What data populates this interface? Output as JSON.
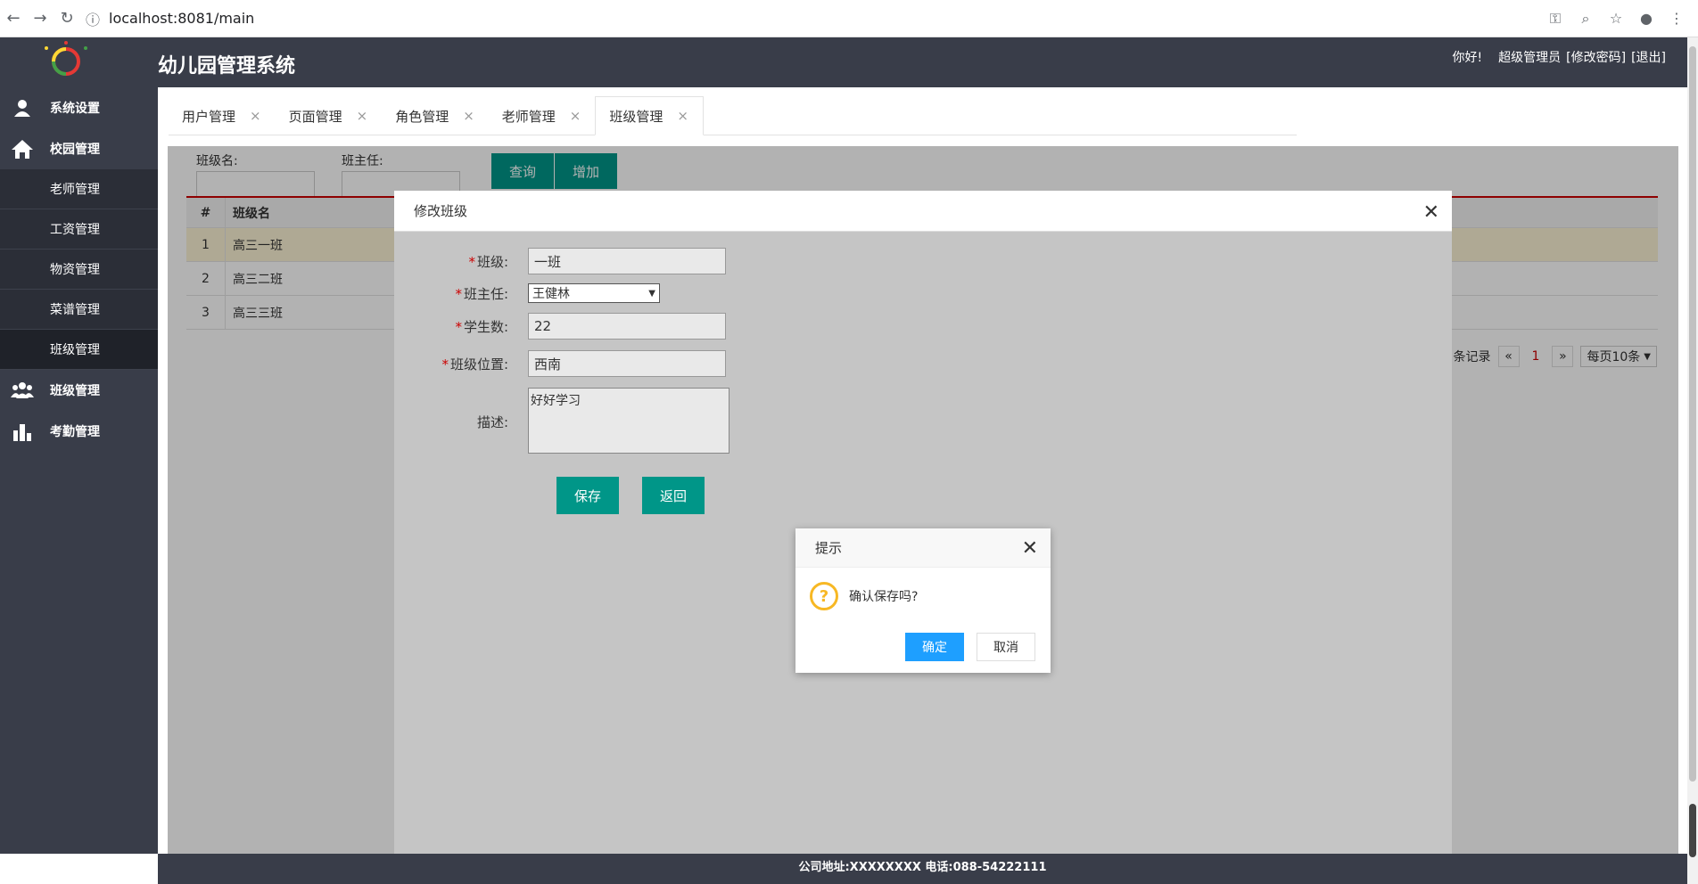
{
  "browser": {
    "url": "localhost:8081/main",
    "back_icon": "←",
    "forward_icon": "→",
    "reload_icon": "↻",
    "info_icon": "ⓘ",
    "key_icon": "⚿",
    "zoom_icon": "⌕",
    "star_icon": "☆",
    "profile_icon": "●",
    "menu_icon": "⋮"
  },
  "header": {
    "title": "幼儿园管理系统",
    "greeting": "你好!",
    "user": "超级管理员",
    "change_password": "[修改密码]",
    "logout": "[退出]"
  },
  "sidebar": {
    "items": [
      {
        "label": "系统设置",
        "icon": "user-icon",
        "glyph": "👤"
      },
      {
        "label": "校园管理",
        "icon": "home-icon",
        "glyph": "⌂"
      }
    ],
    "sub_items": [
      {
        "label": "老师管理"
      },
      {
        "label": "工资管理"
      },
      {
        "label": "物资管理"
      },
      {
        "label": "菜谱管理"
      },
      {
        "label": "班级管理"
      }
    ],
    "items_after": [
      {
        "label": "班级管理",
        "icon": "group-icon",
        "glyph": "👥"
      },
      {
        "label": "考勤管理",
        "icon": "bar-chart-icon",
        "glyph": "▟"
      }
    ]
  },
  "tabs": [
    {
      "label": "用户管理",
      "close": "×"
    },
    {
      "label": "页面管理",
      "close": "×"
    },
    {
      "label": "角色管理",
      "close": "×"
    },
    {
      "label": "老师管理",
      "close": "×"
    },
    {
      "label": "班级管理",
      "close": "×"
    }
  ],
  "search": {
    "class_name_label": "班级名:",
    "teacher_label": "班主任:",
    "query_button": "查询",
    "add_button": "增加"
  },
  "table": {
    "headers": [
      "#",
      "班级名"
    ],
    "rows": [
      {
        "num": "1",
        "name": "高三一班"
      },
      {
        "num": "2",
        "name": "高三二班"
      },
      {
        "num": "3",
        "name": "高三三班"
      }
    ]
  },
  "pager": {
    "records_text": "条记录",
    "prev": "«",
    "page": "1",
    "next": "»",
    "page_size": "每页10条"
  },
  "modal": {
    "title": "修改班级",
    "close": "✕",
    "fields": {
      "class_label": "班级:",
      "class_value": "一班",
      "teacher_label": "班主任:",
      "teacher_value": "王健林",
      "students_label": "学生数:",
      "students_value": "22",
      "location_label": "班级位置:",
      "location_value": "西南",
      "desc_label": "描述:",
      "desc_value": "好好学习"
    },
    "required_mark": "*",
    "save_button": "保存",
    "back_button": "返回"
  },
  "dialog": {
    "title": "提示",
    "close": "✕",
    "icon": "?",
    "message": "确认保存吗?",
    "ok_button": "确定",
    "cancel_button": "取消"
  },
  "footer": {
    "text": "公司地址:XXXXXXXX 电话:088-54222111"
  }
}
